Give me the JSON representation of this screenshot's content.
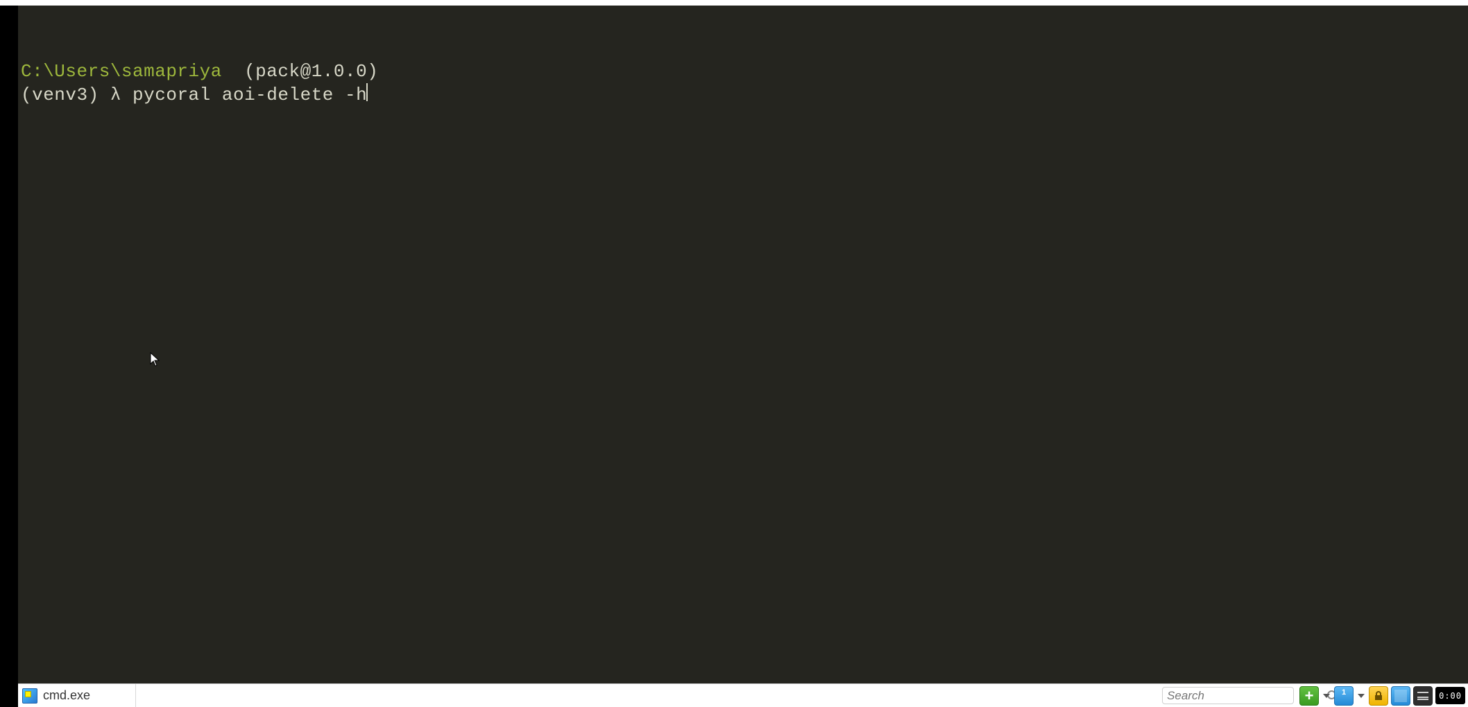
{
  "terminal": {
    "path": "C:\\Users\\samapriya",
    "package": "(pack@1.0.0)",
    "venv": "(venv3)",
    "lambda": "λ",
    "command": "pycoral aoi-delete -h"
  },
  "tab": {
    "label": "cmd.exe"
  },
  "search": {
    "placeholder": "Search"
  },
  "clock": {
    "time": "0:00"
  },
  "colors": {
    "bg": "#25251f",
    "path": "#9db73c",
    "fg": "#d8d8c8"
  }
}
